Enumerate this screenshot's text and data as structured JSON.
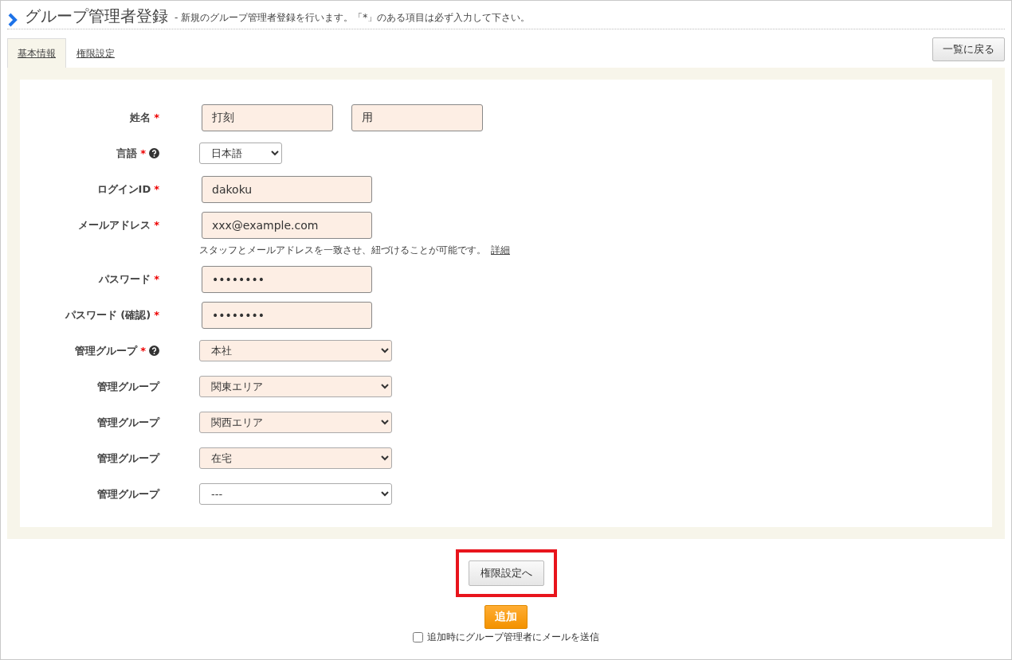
{
  "header": {
    "title": "グループ管理者登録",
    "description": "- 新規のグループ管理者登録を行います。「*」のある項目は必ず入力して下さい。"
  },
  "tabs": [
    {
      "label": "基本情報",
      "selected": true
    },
    {
      "label": "権限設定",
      "selected": false
    }
  ],
  "back_button": "一覧に戻る",
  "fields": [
    {
      "kind": "text_pair",
      "label": "姓名",
      "required": "*",
      "help": false,
      "values": [
        "打刻",
        "用"
      ]
    },
    {
      "kind": "select_short",
      "label": "言語",
      "required": "*",
      "help": true,
      "value": "日本語",
      "highlighted": false
    },
    {
      "kind": "text",
      "label": "ログインID",
      "required": "*",
      "help": false,
      "value": "dakoku"
    },
    {
      "kind": "text",
      "label": "メールアドレス",
      "required": "*",
      "help": false,
      "value": "xxx@example.com",
      "hint": "スタッフとメールアドレスを一致させ、紐づけることが可能です。",
      "hint_link": "詳細"
    },
    {
      "kind": "password",
      "label": "パスワード",
      "required": "*",
      "help": false,
      "value": "••••••••"
    },
    {
      "kind": "password",
      "label": "パスワード (確認)",
      "required": "*",
      "help": false,
      "value": "••••••••"
    },
    {
      "kind": "select",
      "label": "管理グループ",
      "required": "*",
      "help": true,
      "value": "本社",
      "highlighted": true
    },
    {
      "kind": "select",
      "label": "管理グループ",
      "required": false,
      "help": false,
      "value": "関東エリア",
      "highlighted": true
    },
    {
      "kind": "select",
      "label": "管理グループ",
      "required": false,
      "help": false,
      "value": "関西エリア",
      "highlighted": true
    },
    {
      "kind": "select",
      "label": "管理グループ",
      "required": false,
      "help": false,
      "value": "在宅",
      "highlighted": true
    },
    {
      "kind": "select",
      "label": "管理グループ",
      "required": false,
      "help": false,
      "value": "---",
      "highlighted": false
    }
  ],
  "next_button": {
    "label": "権限設定へ",
    "highlighted": true
  },
  "add_button": "追加",
  "mail_option": {
    "label": "追加時にグループ管理者にメールを送信",
    "checked": false
  }
}
